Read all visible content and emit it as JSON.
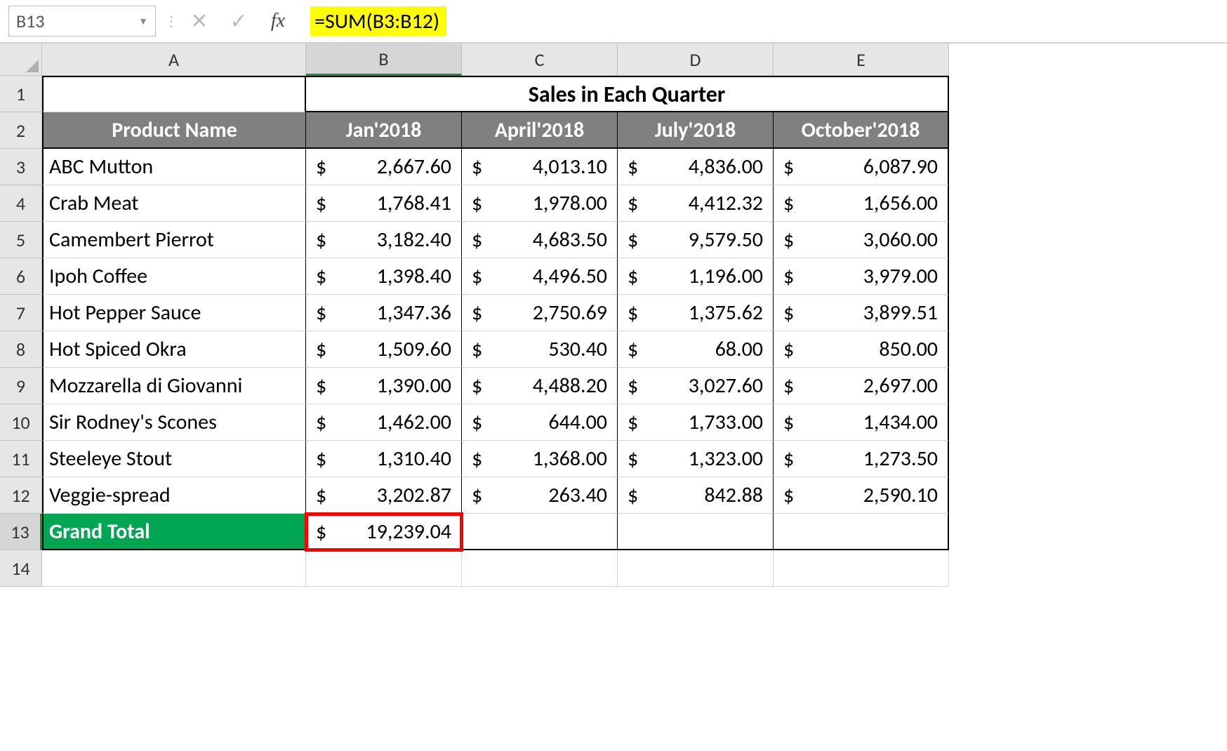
{
  "name_box": "B13",
  "formula": "=SUM(B3:B12)",
  "fx_label": "fx",
  "merged_header": "Sales in Each Quarter",
  "columns": [
    "A",
    "B",
    "C",
    "D",
    "E"
  ],
  "rows": [
    "1",
    "2",
    "3",
    "4",
    "5",
    "6",
    "7",
    "8",
    "9",
    "10",
    "11",
    "12",
    "13",
    "14"
  ],
  "subheaders": {
    "a": "Product Name",
    "b": "Jan'2018",
    "c": "April'2018",
    "d": "July'2018",
    "e": "October'2018"
  },
  "products": [
    {
      "name": "ABC Mutton",
      "b": "2,667.60",
      "c": "4,013.10",
      "d": "4,836.00",
      "e": "6,087.90"
    },
    {
      "name": "Crab Meat",
      "b": "1,768.41",
      "c": "1,978.00",
      "d": "4,412.32",
      "e": "1,656.00"
    },
    {
      "name": "Camembert Pierrot",
      "b": "3,182.40",
      "c": "4,683.50",
      "d": "9,579.50",
      "e": "3,060.00"
    },
    {
      "name": "Ipoh Coffee",
      "b": "1,398.40",
      "c": "4,496.50",
      "d": "1,196.00",
      "e": "3,979.00"
    },
    {
      "name": "Hot Pepper Sauce",
      "b": "1,347.36",
      "c": "2,750.69",
      "d": "1,375.62",
      "e": "3,899.51"
    },
    {
      "name": " Hot Spiced Okra",
      "b": "1,509.60",
      "c": "530.40",
      "d": "68.00",
      "e": "850.00"
    },
    {
      "name": "Mozzarella di Giovanni",
      "b": "1,390.00",
      "c": "4,488.20",
      "d": "3,027.60",
      "e": "2,697.00"
    },
    {
      "name": "Sir Rodney's Scones",
      "b": "1,462.00",
      "c": "644.00",
      "d": "1,733.00",
      "e": "1,434.00"
    },
    {
      "name": "Steeleye Stout",
      "b": "1,310.40",
      "c": "1,368.00",
      "d": "1,323.00",
      "e": "1,273.50"
    },
    {
      "name": "Veggie-spread",
      "b": "3,202.87",
      "c": "263.40",
      "d": "842.88",
      "e": "2,590.10"
    }
  ],
  "grand_total_label": "Grand Total",
  "grand_total_b": "19,239.04",
  "currency": "$",
  "chart_data": {
    "type": "table",
    "title": "Sales in Each Quarter",
    "columns": [
      "Product Name",
      "Jan'2018",
      "April'2018",
      "July'2018",
      "October'2018"
    ],
    "rows": [
      [
        "ABC Mutton",
        2667.6,
        4013.1,
        4836.0,
        6087.9
      ],
      [
        "Crab Meat",
        1768.41,
        1978.0,
        4412.32,
        1656.0
      ],
      [
        "Camembert Pierrot",
        3182.4,
        4683.5,
        9579.5,
        3060.0
      ],
      [
        "Ipoh Coffee",
        1398.4,
        4496.5,
        1196.0,
        3979.0
      ],
      [
        "Hot Pepper Sauce",
        1347.36,
        2750.69,
        1375.62,
        3899.51
      ],
      [
        "Hot Spiced Okra",
        1509.6,
        530.4,
        68.0,
        850.0
      ],
      [
        "Mozzarella di Giovanni",
        1390.0,
        4488.2,
        3027.6,
        2697.0
      ],
      [
        "Sir Rodney's Scones",
        1462.0,
        644.0,
        1733.0,
        1434.0
      ],
      [
        "Steeleye Stout",
        1310.4,
        1368.0,
        1323.0,
        1273.5
      ],
      [
        "Veggie-spread",
        3202.87,
        263.4,
        842.88,
        2590.1
      ],
      [
        "Grand Total",
        19239.04,
        null,
        null,
        null
      ]
    ]
  }
}
